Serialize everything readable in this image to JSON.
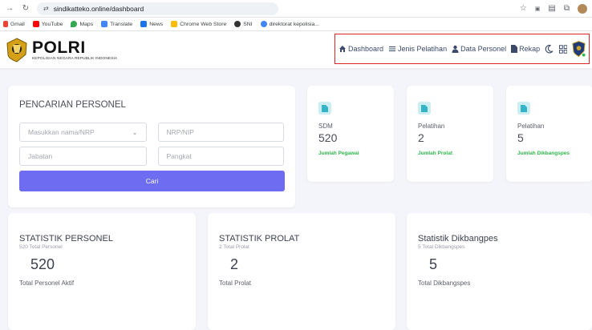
{
  "browser": {
    "url": "sindikatteko.online/dashboard",
    "bookmarks": [
      "Gmail",
      "YouTube",
      "Maps",
      "Translate",
      "News",
      "Chrome Web Store",
      "SNI",
      "direktorat kepolisia..."
    ]
  },
  "header": {
    "logo_title": "POLRI",
    "logo_subtitle": "KEPOLISIAN NEGARA REPUBLIK INDONESIA",
    "nav": {
      "dashboard": "Dashboard",
      "jenis_pelatihan": "Jenis Pelatihan",
      "data_personel": "Data Personel",
      "rekap": "Rekap"
    }
  },
  "search": {
    "title": "PENCARIAN PERSONEL",
    "name_placeholder": "Masukkan nama/NRP",
    "nrp_placeholder": "NRP/NIP",
    "jabatan_placeholder": "Jabatan",
    "pangkat_placeholder": "Pangkat",
    "button": "Cari"
  },
  "stats": [
    {
      "label": "SDM",
      "value": "520",
      "sub": "Jumlah Pegawai"
    },
    {
      "label": "Pelatihan",
      "value": "2",
      "sub": "Jumlah Prolat"
    },
    {
      "label": "Pelatihan",
      "value": "5",
      "sub": "Jumlah Dikbangspes"
    }
  ],
  "summary": [
    {
      "title": "STATISTIK PERSONEL",
      "sub": "520 Total Personel",
      "value": "520",
      "foot": "Total Personel Aktif"
    },
    {
      "title": "STATISTIK PROLAT",
      "sub": "2 Total Prolat",
      "value": "2",
      "foot": "Total Prolat"
    },
    {
      "title": "Statistik Dikbangpes",
      "sub": "5 Total Dikbangspes",
      "value": "5",
      "foot": "Total Dikbangspes"
    }
  ],
  "colors": {
    "accent": "#6e6cf0",
    "success": "#2fb84c",
    "highlight": "#e02424",
    "icon_bg": "#cbeef3"
  }
}
